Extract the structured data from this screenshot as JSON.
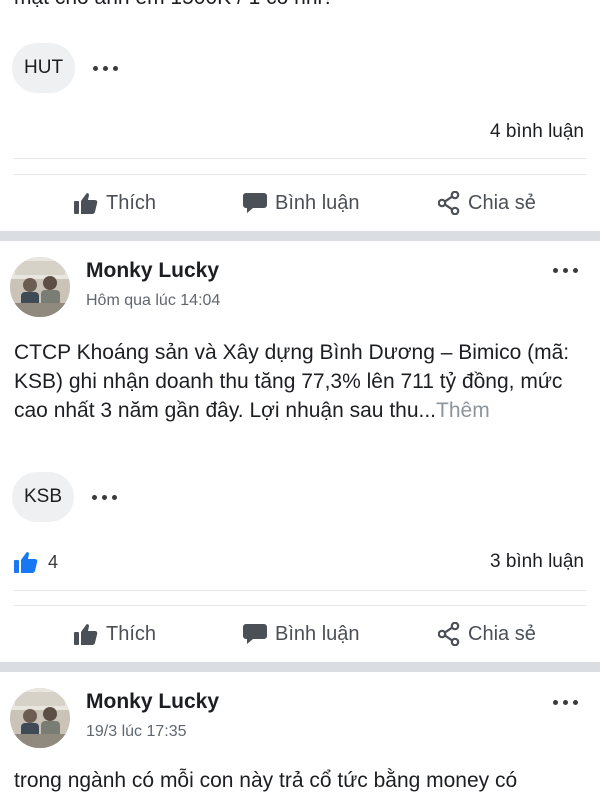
{
  "top_post": {
    "cut_text": "mặt cho anh em 1500K / 1 cổ nhỉ?",
    "tag": "HUT",
    "comment_count": "4 bình luận"
  },
  "actions": {
    "like": "Thích",
    "comment": "Bình luận",
    "share": "Chia sẻ"
  },
  "posts": [
    {
      "author": "Monky Lucky",
      "time": "Hôm qua lúc 14:04",
      "text": "CTCP Khoáng sản và Xây dựng Bình Dương – Bimico (mã: KSB) ghi nhận doanh thu tăng 77,3% lên 711 tỷ đồng, mức cao nhất 3 năm gần đây. Lợi nhuận sau thu...",
      "see_more": "Thêm",
      "tag": "KSB",
      "like_count": "4",
      "comment_count": "3 bình luận"
    },
    {
      "author": "Monky Lucky",
      "time": "19/3 lúc 17:35",
      "text": "trong ngành có mỗi con này trả cổ tức bằng money có"
    }
  ],
  "icons": {
    "like": "thumbs-up-icon",
    "comment": "speech-bubble-icon",
    "share": "share-icon",
    "more": "more-dots-icon",
    "reaction": "like-reaction-icon"
  },
  "colors": {
    "reaction_blue": "#1877f2",
    "divider": "#dadde1",
    "tag_bg": "#eef0f2"
  }
}
